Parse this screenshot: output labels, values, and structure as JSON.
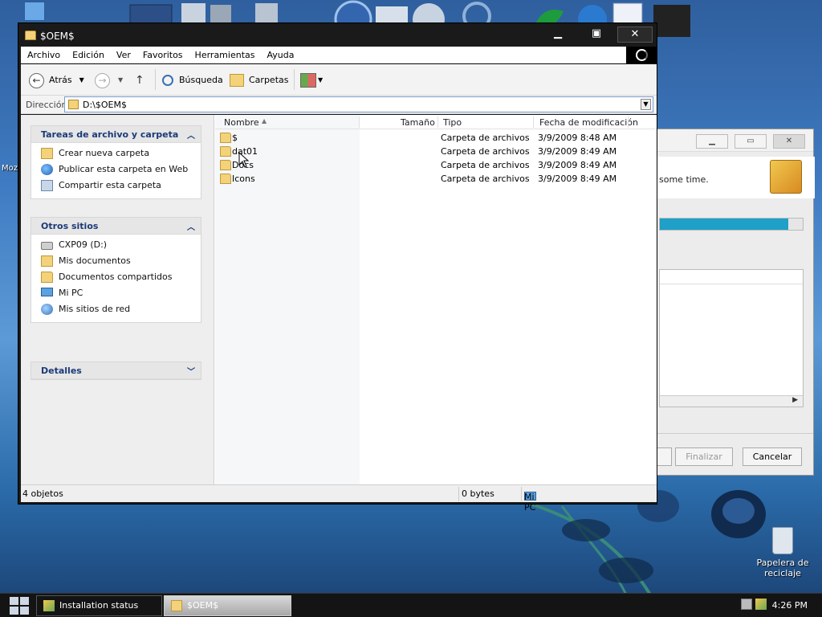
{
  "desktop": {
    "recycle_bin_label": "Papelera de reciclaje",
    "left_edge_label": "Moz"
  },
  "installer": {
    "message": "some time.",
    "progress": 0.9,
    "finish_label": "Finalizar",
    "cancel_label": "Cancelar"
  },
  "explorer": {
    "title": "$OEM$",
    "menu": [
      "Archivo",
      "Edición",
      "Ver",
      "Favoritos",
      "Herramientas",
      "Ayuda"
    ],
    "toolbar": {
      "back_label": "Atrás",
      "search_label": "Búsqueda",
      "folders_label": "Carpetas"
    },
    "address": {
      "label": "Dirección",
      "value": "D:\\$OEM$"
    },
    "tasks_panel": {
      "title": "Tareas de archivo y carpeta",
      "items": [
        "Crear nueva carpeta",
        "Publicar esta carpeta en Web",
        "Compartir esta carpeta"
      ]
    },
    "other_places": {
      "title": "Otros sitios",
      "items": [
        "CXP09 (D:)",
        "Mis documentos",
        "Documentos compartidos",
        "Mi PC",
        "Mis sitios de red"
      ]
    },
    "details": {
      "title": "Detalles"
    },
    "columns": [
      "Nombre",
      "Tamaño",
      "Tipo",
      "Fecha de modificación"
    ],
    "files": [
      {
        "name": "$",
        "size": "",
        "type": "Carpeta de archivos",
        "date": "3/9/2009 8:48 AM"
      },
      {
        "name": "dat01",
        "size": "",
        "type": "Carpeta de archivos",
        "date": "3/9/2009 8:49 AM"
      },
      {
        "name": "Docs",
        "size": "",
        "type": "Carpeta de archivos",
        "date": "3/9/2009 8:49 AM"
      },
      {
        "name": "Icons",
        "size": "",
        "type": "Carpeta de archivos",
        "date": "3/9/2009 8:49 AM"
      }
    ],
    "status": {
      "count": "4 objetos",
      "size": "0 bytes",
      "location": "Mi PC"
    }
  },
  "taskbar": {
    "tasks": [
      "Installation status",
      "$OEM$"
    ],
    "clock": "4:26 PM"
  }
}
